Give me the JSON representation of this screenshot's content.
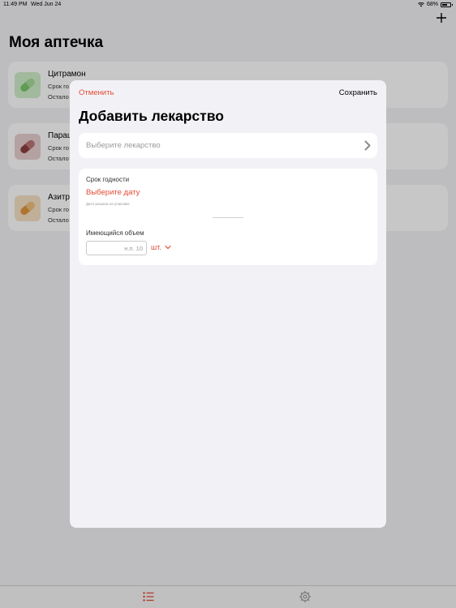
{
  "status_bar": {
    "time": "11:49 PM",
    "date": "Wed Jun 24",
    "battery": "68%"
  },
  "app": {
    "title": "Моя аптечка",
    "medicines": [
      {
        "name": "Цитрамон",
        "line1": "Срок го",
        "line2": "Остало",
        "color": "#7bc86c"
      },
      {
        "name": "Парац",
        "line1": "Срок го",
        "line2": "Остало",
        "color": "#8e3f3f"
      },
      {
        "name": "Азитр",
        "line1": "Срок го",
        "line2": "Остало",
        "color": "#e0973b"
      }
    ]
  },
  "modal": {
    "cancel_label": "Отменить",
    "save_label": "Сохранить",
    "title": "Добавить лекарство",
    "select_placeholder": "Выберите лекарство",
    "expiry_label": "Срок годности",
    "expiry_picker": "Выберите дату",
    "expiry_hint": "Дата указана на упаковке",
    "volume_label": "Имеющийся объем",
    "volume_placeholder": "н.п. 10",
    "unit": "шт."
  },
  "colors": {
    "accent": "#e24a36",
    "tab_active": "#e24a36",
    "tab_inactive": "#8e8e93"
  },
  "icons": {
    "add": "plus-icon",
    "tab_list": "list-icon",
    "tab_settings": "gear-icon"
  }
}
